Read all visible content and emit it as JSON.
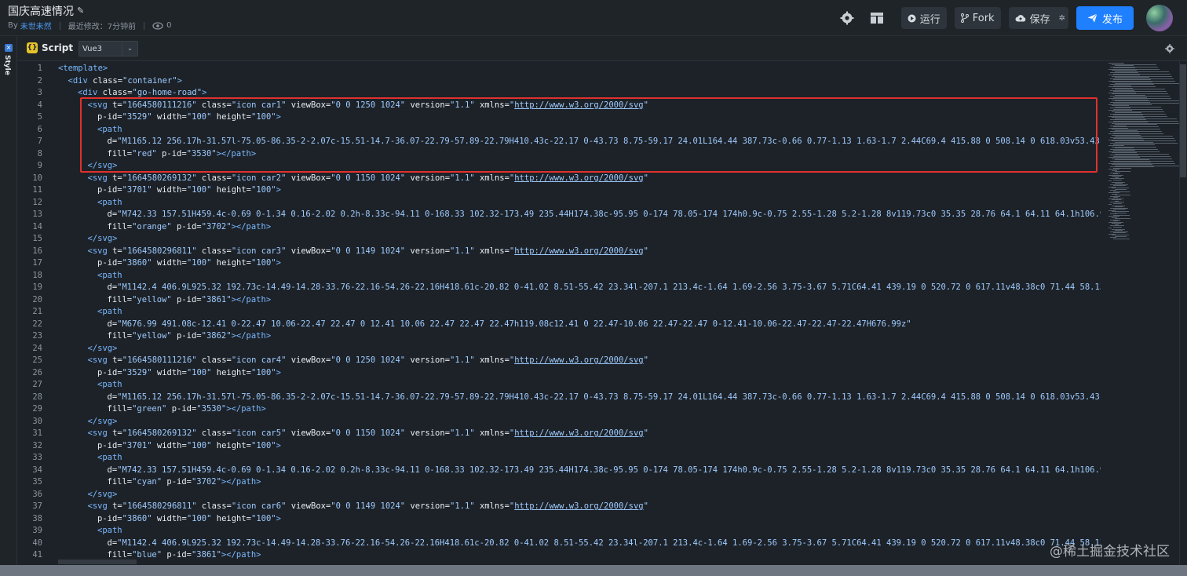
{
  "header": {
    "title": "国庆高速情况",
    "by_label": "By",
    "author": "未世未然",
    "last_modified": "最近修改：7分钟前",
    "views": "0",
    "run_label": "运行",
    "fork_label": "Fork",
    "save_label": "保存",
    "publish_label": "发布"
  },
  "rail": {
    "label": "Style"
  },
  "tabbar": {
    "script_label": "Script",
    "lang_value": "Vue3"
  },
  "editor": {
    "lines": [
      {
        "n": "1",
        "indent": 0,
        "toks": [
          [
            "tag",
            "<template>"
          ]
        ]
      },
      {
        "n": "2",
        "indent": 1,
        "toks": [
          [
            "tag",
            "<div "
          ],
          [
            "attr",
            "class="
          ],
          [
            "str",
            "\"container\""
          ],
          [
            "tag",
            ">"
          ]
        ]
      },
      {
        "n": "3",
        "indent": 2,
        "toks": [
          [
            "tag",
            "<div "
          ],
          [
            "attr",
            "class="
          ],
          [
            "str",
            "\"go-home-road\""
          ],
          [
            "tag",
            ">"
          ]
        ]
      },
      {
        "n": "4",
        "indent": 3,
        "toks": [
          [
            "tag",
            "<svg "
          ],
          [
            "attr",
            "t="
          ],
          [
            "str",
            "\"1664580111216\" "
          ],
          [
            "attr",
            "class="
          ],
          [
            "str",
            "\"icon car1\" "
          ],
          [
            "attr",
            "viewBox="
          ],
          [
            "str",
            "\"0 0 1250 1024\" "
          ],
          [
            "attr",
            "version="
          ],
          [
            "str",
            "\"1.1\" "
          ],
          [
            "attr",
            "xmlns="
          ],
          [
            "str",
            "\""
          ],
          [
            "url",
            "http://www.w3.org/2000/svg"
          ],
          [
            "str",
            "\""
          ]
        ]
      },
      {
        "n": "5",
        "indent": 4,
        "toks": [
          [
            "attr",
            "p-id="
          ],
          [
            "str",
            "\"3529\" "
          ],
          [
            "attr",
            "width="
          ],
          [
            "str",
            "\"100\" "
          ],
          [
            "attr",
            "height="
          ],
          [
            "str",
            "\"100\""
          ],
          [
            "tag",
            ">"
          ]
        ]
      },
      {
        "n": "6",
        "indent": 4,
        "toks": [
          [
            "tag",
            "<path"
          ]
        ]
      },
      {
        "n": "7",
        "indent": 5,
        "toks": [
          [
            "attr",
            "d="
          ],
          [
            "str",
            "\"M1165.12 256.17h-31.57l-75.05-86.35-2-2.07c-15.51-14.7-36.07-22.79-57.89-22.79H410.43c-22.17 0-43.73 8.75-59.17 24.01L164.44 387.73c-0.66 0.77-1.13 1.63-1.7 2.44C69.4 415.88 0 508.14 0 618.03v53.43c"
          ]
        ]
      },
      {
        "n": "8",
        "indent": 5,
        "toks": [
          [
            "attr",
            "fill="
          ],
          [
            "str",
            "\"red\" "
          ],
          [
            "attr",
            "p-id="
          ],
          [
            "str",
            "\"3530\""
          ],
          [
            "tag",
            "></path>"
          ]
        ]
      },
      {
        "n": "9",
        "indent": 3,
        "toks": [
          [
            "tag",
            "</svg>"
          ]
        ]
      },
      {
        "n": "10",
        "indent": 3,
        "toks": [
          [
            "tag",
            "<svg "
          ],
          [
            "attr",
            "t="
          ],
          [
            "str",
            "\"1664580269132\" "
          ],
          [
            "attr",
            "class="
          ],
          [
            "str",
            "\"icon car2\" "
          ],
          [
            "attr",
            "viewBox="
          ],
          [
            "str",
            "\"0 0 1150 1024\" "
          ],
          [
            "attr",
            "version="
          ],
          [
            "str",
            "\"1.1\" "
          ],
          [
            "attr",
            "xmlns="
          ],
          [
            "str",
            "\""
          ],
          [
            "url",
            "http://www.w3.org/2000/svg"
          ],
          [
            "str",
            "\""
          ]
        ]
      },
      {
        "n": "11",
        "indent": 4,
        "toks": [
          [
            "attr",
            "p-id="
          ],
          [
            "str",
            "\"3701\" "
          ],
          [
            "attr",
            "width="
          ],
          [
            "str",
            "\"100\" "
          ],
          [
            "attr",
            "height="
          ],
          [
            "str",
            "\"100\""
          ],
          [
            "tag",
            ">"
          ]
        ]
      },
      {
        "n": "12",
        "indent": 4,
        "toks": [
          [
            "tag",
            "<path"
          ]
        ]
      },
      {
        "n": "13",
        "indent": 5,
        "toks": [
          [
            "attr",
            "d="
          ],
          [
            "str",
            "\"M742.33 157.51H459.4c-0.69 0-1.34 0.16-2.02 0.2h-8.33c-94.11 0-168.33 102.32-173.49 235.44H174.38c-95.95 0-174 78.05-174 174h0.9c-0.75 2.55-1.28 5.2-1.28 8v119.73c0 35.35 28.76 64.1 64.11 64.1h106.9"
          ]
        ]
      },
      {
        "n": "14",
        "indent": 5,
        "toks": [
          [
            "attr",
            "fill="
          ],
          [
            "str",
            "\"orange\" "
          ],
          [
            "attr",
            "p-id="
          ],
          [
            "str",
            "\"3702\""
          ],
          [
            "tag",
            "></path>"
          ]
        ]
      },
      {
        "n": "15",
        "indent": 3,
        "toks": [
          [
            "tag",
            "</svg>"
          ]
        ]
      },
      {
        "n": "16",
        "indent": 3,
        "toks": [
          [
            "tag",
            "<svg "
          ],
          [
            "attr",
            "t="
          ],
          [
            "str",
            "\"1664580296811\" "
          ],
          [
            "attr",
            "class="
          ],
          [
            "str",
            "\"icon car3\" "
          ],
          [
            "attr",
            "viewBox="
          ],
          [
            "str",
            "\"0 0 1149 1024\" "
          ],
          [
            "attr",
            "version="
          ],
          [
            "str",
            "\"1.1\" "
          ],
          [
            "attr",
            "xmlns="
          ],
          [
            "str",
            "\""
          ],
          [
            "url",
            "http://www.w3.org/2000/svg"
          ],
          [
            "str",
            "\""
          ]
        ]
      },
      {
        "n": "17",
        "indent": 4,
        "toks": [
          [
            "attr",
            "p-id="
          ],
          [
            "str",
            "\"3860\" "
          ],
          [
            "attr",
            "width="
          ],
          [
            "str",
            "\"100\" "
          ],
          [
            "attr",
            "height="
          ],
          [
            "str",
            "\"100\""
          ],
          [
            "tag",
            ">"
          ]
        ]
      },
      {
        "n": "18",
        "indent": 4,
        "toks": [
          [
            "tag",
            "<path"
          ]
        ]
      },
      {
        "n": "19",
        "indent": 5,
        "toks": [
          [
            "attr",
            "d="
          ],
          [
            "str",
            "\"M1142.4 406.9L925.32 192.73c-14.49-14.28-33.76-22.16-54.26-22.16H418.61c-20.82 0-41.02 8.51-55.42 23.34l-207.1 213.4c-1.64 1.69-2.56 3.75-3.67 5.71C64.41 439.19 0 520.72 0 617.11v48.38c0 71.44 58.13"
          ]
        ]
      },
      {
        "n": "20",
        "indent": 5,
        "toks": [
          [
            "attr",
            "fill="
          ],
          [
            "str",
            "\"yellow\" "
          ],
          [
            "attr",
            "p-id="
          ],
          [
            "str",
            "\"3861\""
          ],
          [
            "tag",
            "></path>"
          ]
        ]
      },
      {
        "n": "21",
        "indent": 4,
        "toks": [
          [
            "tag",
            "<path"
          ]
        ]
      },
      {
        "n": "22",
        "indent": 5,
        "toks": [
          [
            "attr",
            "d="
          ],
          [
            "str",
            "\"M676.99 491.08c-12.41 0-22.47 10.06-22.47 22.47 0 12.41 10.06 22.47 22.47 22.47h119.08c12.41 0 22.47-10.06 22.47-22.47 0-12.41-10.06-22.47-22.47-22.47H676.99z\""
          ]
        ]
      },
      {
        "n": "23",
        "indent": 5,
        "toks": [
          [
            "attr",
            "fill="
          ],
          [
            "str",
            "\"yellow\" "
          ],
          [
            "attr",
            "p-id="
          ],
          [
            "str",
            "\"3862\""
          ],
          [
            "tag",
            "></path>"
          ]
        ]
      },
      {
        "n": "24",
        "indent": 3,
        "toks": [
          [
            "tag",
            "</svg>"
          ]
        ]
      },
      {
        "n": "25",
        "indent": 3,
        "toks": [
          [
            "tag",
            "<svg "
          ],
          [
            "attr",
            "t="
          ],
          [
            "str",
            "\"1664580111216\" "
          ],
          [
            "attr",
            "class="
          ],
          [
            "str",
            "\"icon car4\" "
          ],
          [
            "attr",
            "viewBox="
          ],
          [
            "str",
            "\"0 0 1250 1024\" "
          ],
          [
            "attr",
            "version="
          ],
          [
            "str",
            "\"1.1\" "
          ],
          [
            "attr",
            "xmlns="
          ],
          [
            "str",
            "\""
          ],
          [
            "url",
            "http://www.w3.org/2000/svg"
          ],
          [
            "str",
            "\""
          ]
        ]
      },
      {
        "n": "26",
        "indent": 4,
        "toks": [
          [
            "attr",
            "p-id="
          ],
          [
            "str",
            "\"3529\" "
          ],
          [
            "attr",
            "width="
          ],
          [
            "str",
            "\"100\" "
          ],
          [
            "attr",
            "height="
          ],
          [
            "str",
            "\"100\""
          ],
          [
            "tag",
            ">"
          ]
        ]
      },
      {
        "n": "27",
        "indent": 4,
        "toks": [
          [
            "tag",
            "<path"
          ]
        ]
      },
      {
        "n": "28",
        "indent": 5,
        "toks": [
          [
            "attr",
            "d="
          ],
          [
            "str",
            "\"M1165.12 256.17h-31.57l-75.05-86.35-2-2.07c-15.51-14.7-36.07-22.79-57.89-22.79H410.43c-22.17 0-43.73 8.75-59.17 24.01L164.44 387.73c-0.66 0.77-1.13 1.63-1.7 2.44C69.4 415.88 0 508.14 0 618.03v53.43c"
          ]
        ]
      },
      {
        "n": "29",
        "indent": 5,
        "toks": [
          [
            "attr",
            "fill="
          ],
          [
            "str",
            "\"green\" "
          ],
          [
            "attr",
            "p-id="
          ],
          [
            "str",
            "\"3530\""
          ],
          [
            "tag",
            "></path>"
          ]
        ]
      },
      {
        "n": "30",
        "indent": 3,
        "toks": [
          [
            "tag",
            "</svg>"
          ]
        ]
      },
      {
        "n": "31",
        "indent": 3,
        "toks": [
          [
            "tag",
            "<svg "
          ],
          [
            "attr",
            "t="
          ],
          [
            "str",
            "\"1664580269132\" "
          ],
          [
            "attr",
            "class="
          ],
          [
            "str",
            "\"icon car5\" "
          ],
          [
            "attr",
            "viewBox="
          ],
          [
            "str",
            "\"0 0 1150 1024\" "
          ],
          [
            "attr",
            "version="
          ],
          [
            "str",
            "\"1.1\" "
          ],
          [
            "attr",
            "xmlns="
          ],
          [
            "str",
            "\""
          ],
          [
            "url",
            "http://www.w3.org/2000/svg"
          ],
          [
            "str",
            "\""
          ]
        ]
      },
      {
        "n": "32",
        "indent": 4,
        "toks": [
          [
            "attr",
            "p-id="
          ],
          [
            "str",
            "\"3701\" "
          ],
          [
            "attr",
            "width="
          ],
          [
            "str",
            "\"100\" "
          ],
          [
            "attr",
            "height="
          ],
          [
            "str",
            "\"100\""
          ],
          [
            "tag",
            ">"
          ]
        ]
      },
      {
        "n": "33",
        "indent": 4,
        "toks": [
          [
            "tag",
            "<path"
          ]
        ]
      },
      {
        "n": "34",
        "indent": 5,
        "toks": [
          [
            "attr",
            "d="
          ],
          [
            "str",
            "\"M742.33 157.51H459.4c-0.69 0-1.34 0.16-2.02 0.2h-8.33c-94.11 0-168.33 102.32-173.49 235.44H174.38c-95.95 0-174 78.05-174 174h0.9c-0.75 2.55-1.28 5.2-1.28 8v119.73c0 35.35 28.76 64.1 64.11 64.1h106.9"
          ]
        ]
      },
      {
        "n": "35",
        "indent": 5,
        "toks": [
          [
            "attr",
            "fill="
          ],
          [
            "str",
            "\"cyan\" "
          ],
          [
            "attr",
            "p-id="
          ],
          [
            "str",
            "\"3702\""
          ],
          [
            "tag",
            "></path>"
          ]
        ]
      },
      {
        "n": "36",
        "indent": 3,
        "toks": [
          [
            "tag",
            "</svg>"
          ]
        ]
      },
      {
        "n": "37",
        "indent": 3,
        "toks": [
          [
            "tag",
            "<svg "
          ],
          [
            "attr",
            "t="
          ],
          [
            "str",
            "\"1664580296811\" "
          ],
          [
            "attr",
            "class="
          ],
          [
            "str",
            "\"icon car6\" "
          ],
          [
            "attr",
            "viewBox="
          ],
          [
            "str",
            "\"0 0 1149 1024\" "
          ],
          [
            "attr",
            "version="
          ],
          [
            "str",
            "\"1.1\" "
          ],
          [
            "attr",
            "xmlns="
          ],
          [
            "str",
            "\""
          ],
          [
            "url",
            "http://www.w3.org/2000/svg"
          ],
          [
            "str",
            "\""
          ]
        ]
      },
      {
        "n": "38",
        "indent": 4,
        "toks": [
          [
            "attr",
            "p-id="
          ],
          [
            "str",
            "\"3860\" "
          ],
          [
            "attr",
            "width="
          ],
          [
            "str",
            "\"100\" "
          ],
          [
            "attr",
            "height="
          ],
          [
            "str",
            "\"100\""
          ],
          [
            "tag",
            ">"
          ]
        ]
      },
      {
        "n": "39",
        "indent": 4,
        "toks": [
          [
            "tag",
            "<path"
          ]
        ]
      },
      {
        "n": "40",
        "indent": 5,
        "toks": [
          [
            "attr",
            "d="
          ],
          [
            "str",
            "\"M1142.4 406.9L925.32 192.73c-14.49-14.28-33.76-22.16-54.26-22.16H418.61c-20.82 0-41.02 8.51-55.42 23.34l-207.1 213.4c-1.64 1.69-2.56 3.75-3.67 5.71C64.41 439.19 0 520.72 0 617.11v48.38c0 71.44 58.13"
          ]
        ]
      },
      {
        "n": "41",
        "indent": 5,
        "toks": [
          [
            "attr",
            "fill="
          ],
          [
            "str",
            "\"blue\" "
          ],
          [
            "attr",
            "p-id="
          ],
          [
            "str",
            "\"3861\""
          ],
          [
            "tag",
            "></path>"
          ]
        ]
      }
    ]
  },
  "watermark": "@稀土掘金技术社区",
  "colors": {
    "accent": "#1e80ff",
    "highlight_border": "#e0312d"
  }
}
